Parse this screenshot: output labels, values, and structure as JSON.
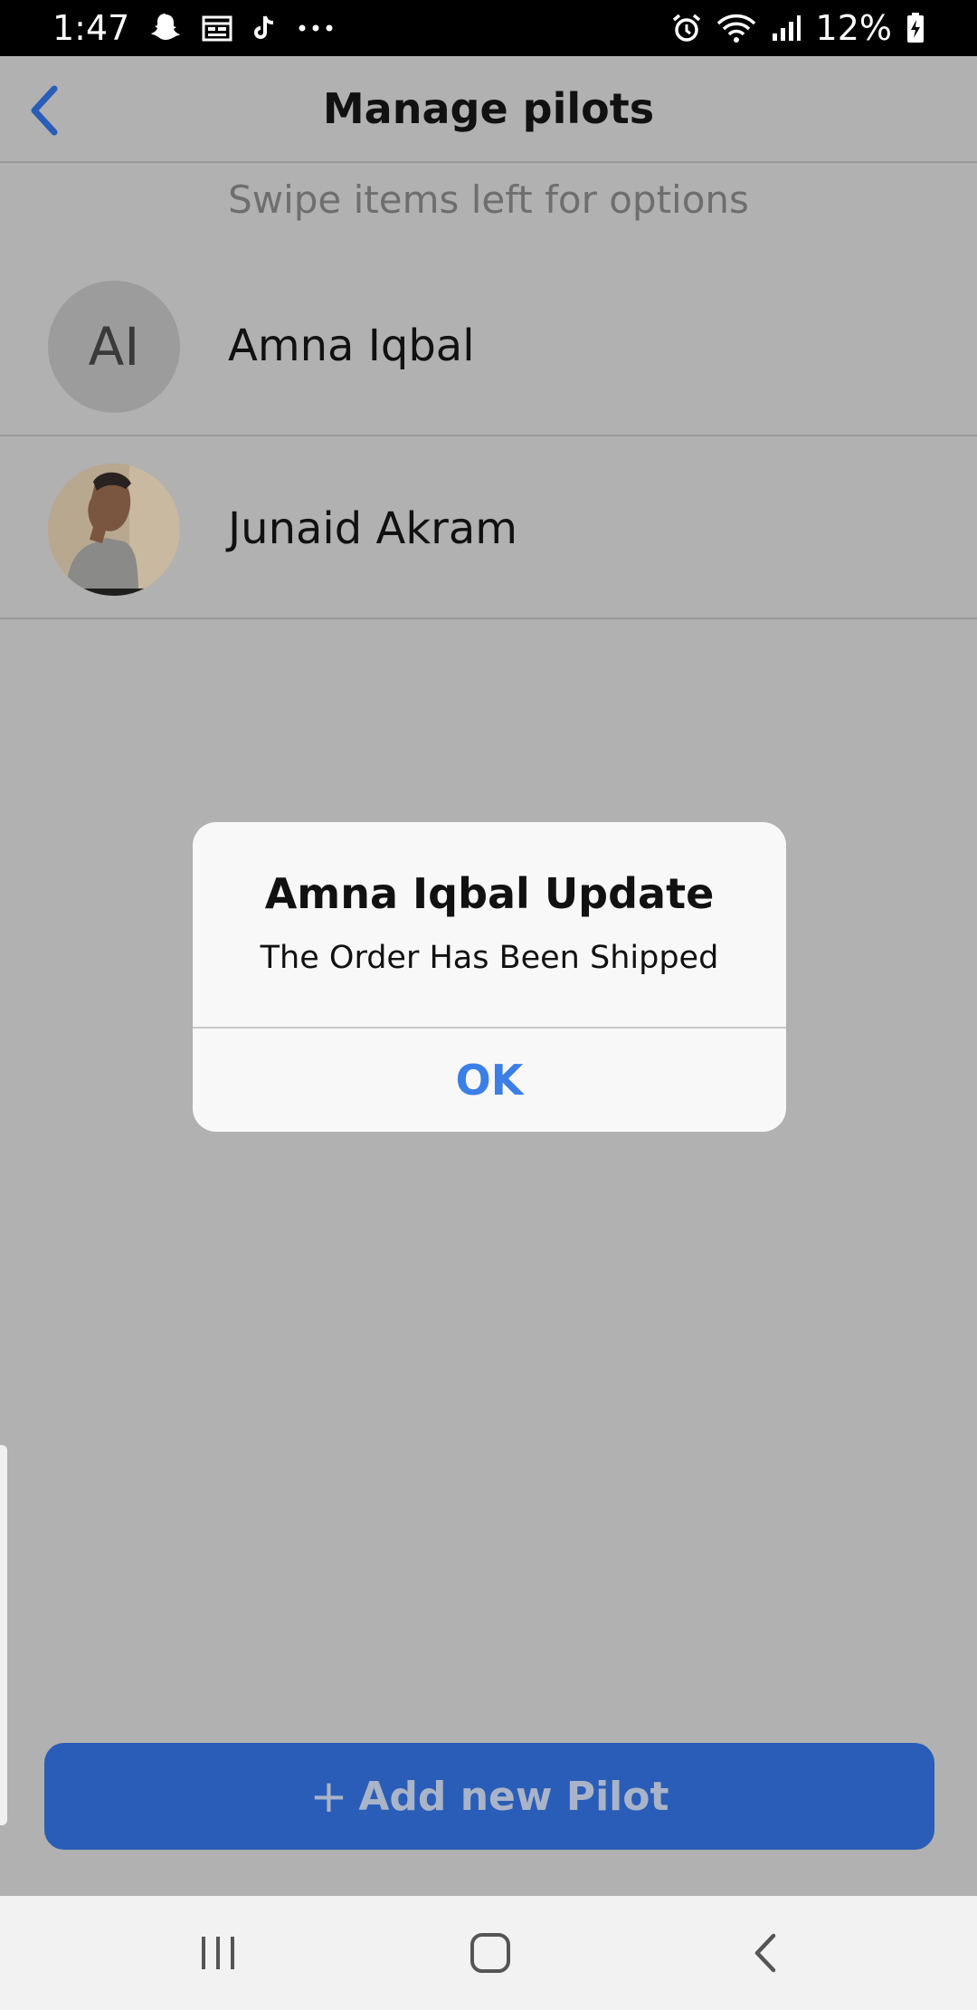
{
  "status_bar": {
    "time": "1:47",
    "battery": "12%",
    "icons": [
      "snapchat-icon",
      "calendar-icon",
      "tiktok-icon",
      "more-dots-icon",
      "alarm-icon",
      "wifi-icon",
      "signal-icon",
      "battery-charging-icon"
    ]
  },
  "header": {
    "title": "Manage pilots",
    "back_icon": "chevron-left-icon"
  },
  "hint": "Swipe items left for options",
  "pilots": [
    {
      "name": "Amna Iqbal",
      "initials": "AI"
    },
    {
      "name": "Junaid Akram",
      "initials": ""
    }
  ],
  "dialog": {
    "title": "Amna Iqbal Update",
    "message": "The Order Has Been Shipped",
    "ok_label": "OK"
  },
  "add_button": {
    "icon": "+",
    "label": "Add new Pilot"
  },
  "colors": {
    "accent": "#2a5db7",
    "ok_text": "#3b7fe6",
    "overlay_bg": "#b1b1b1"
  }
}
